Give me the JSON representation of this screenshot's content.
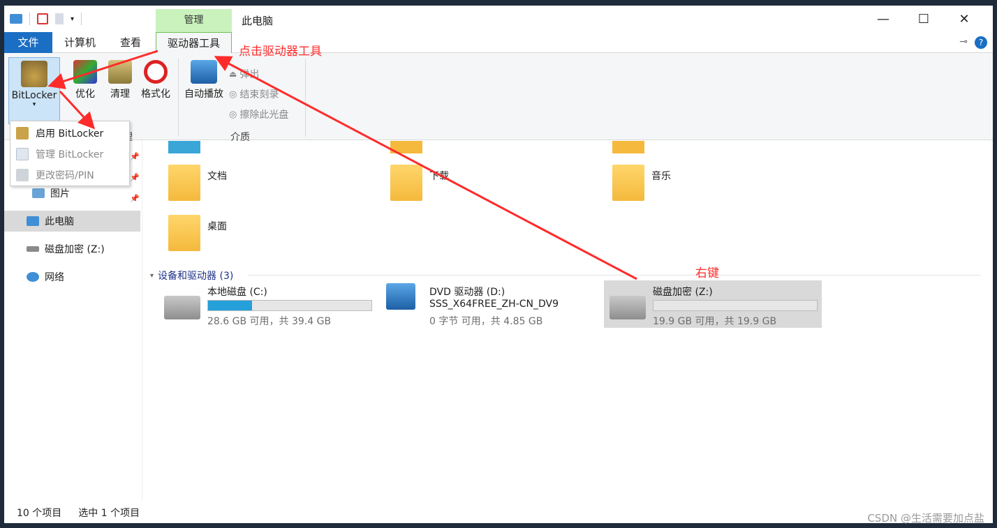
{
  "window": {
    "title": "此电脑",
    "context_group": "管理",
    "controls": {
      "minimize": "—",
      "maximize": "☐",
      "close": "✕"
    }
  },
  "tabs": {
    "file": "文件",
    "computer": "计算机",
    "view": "查看",
    "drive_tools": "驱动器工具"
  },
  "ribbon": {
    "bitlocker": "BitLocker",
    "optimize": "优化",
    "cleanup": "清理",
    "format": "格式化",
    "autoplay": "自动播放",
    "eject": "弹出",
    "finish_burn": "结束刻录",
    "erase_disc": "擦除此光盘",
    "group_media": "介质",
    "group_manage_partial": "理"
  },
  "bitlocker_menu": {
    "enable": "启用 BitLocker",
    "manage": "管理 BitLocker",
    "change_pin": "更改密码/PIN"
  },
  "nav": {
    "pictures": "图片",
    "this_pc": "此电脑",
    "encrypted_drive": "磁盘加密 (Z:)",
    "network": "网络"
  },
  "folders": {
    "documents": "文档",
    "downloads": "下载",
    "music": "音乐",
    "desktop": "桌面"
  },
  "devices": {
    "header": "设备和驱动器 (3)",
    "drives": [
      {
        "name": "本地磁盘 (C:)",
        "sub": "28.6 GB 可用，共 39.4 GB",
        "fill": 0.27
      },
      {
        "name": "DVD 驱动器 (D:)",
        "name2": "SSS_X64FREE_ZH-CN_DV9",
        "sub": "0 字节 可用，共 4.85 GB"
      },
      {
        "name": "磁盘加密 (Z:)",
        "sub": "19.9 GB 可用，共 19.9 GB",
        "fill": 0.0
      }
    ]
  },
  "status": {
    "count": "10 个项目",
    "selected": "选中 1 个项目"
  },
  "annotations": {
    "click_drive_tools": "点击驱动器工具",
    "right_click": "右键"
  },
  "watermark": "CSDN @生活需要加点盐",
  "colors": {
    "accent": "#1a6fc4",
    "context_tab": "#c9f2bd",
    "annotation": "#ff2b2b",
    "drive_fill": "#26a0da"
  }
}
